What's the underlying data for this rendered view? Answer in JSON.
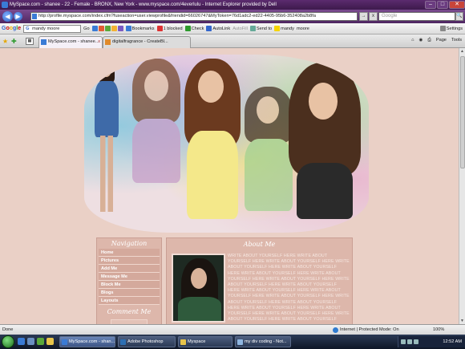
{
  "window": {
    "title": "MySpace.com - shanee - 22 - Female - BRONX, New York - www.myspace.com/4everlulu - Internet Explorer provided by Dell",
    "controls": {
      "minimize": "–",
      "maximize": "□",
      "close": "✕"
    }
  },
  "address_bar": {
    "url": "http://profile.myspace.com/index.cfm?fuseaction=user.viewprofile&friendid=66026747&MyToken=76d1adc2-ed22-4405-95b6-352408a2b8fa",
    "search_placeholder": "Google",
    "go_label": "→",
    "refresh_label": "x",
    "search_btn": "🔍"
  },
  "google_toolbar": {
    "logo_letters": [
      "G",
      "o",
      "o",
      "g",
      "l",
      "e"
    ],
    "search_value": "mandy moore",
    "go_label": "Go",
    "bookmarks_label": "Bookmarks",
    "blocked_label": "1 blocked",
    "check_label": "Check",
    "autolink_label": "AutoLink",
    "autofill_label": "AutoFill",
    "sendto_label": "Send to",
    "term1": "mandy",
    "term2": "moore",
    "settings_label": "Settings"
  },
  "tabs": {
    "active_label": "MySpace.com - shanee...",
    "inactive_label": "digitalfragrance - CreateBl...",
    "close_label": "x",
    "grid_label": "▦",
    "command_bar": [
      "Page",
      "Tools"
    ]
  },
  "profile": {
    "navigation_title": "Navigation",
    "nav_links": [
      "Home",
      "Pictures",
      "Add Me",
      "Message Me",
      "Block Me",
      "Blogs",
      "Layouts"
    ],
    "comment_title": "Comment Me",
    "about_title": "About Me",
    "about_text": "WRITE ABOUT YOURSELF HERE WRITE ABOUT YOURSELF HERE WRITE ABOUT YOURSELF HERE WRITE ABOUT YOURSELF HERE WRITE ABOUT YOURSELF HERE WRITE ABOUT YOURSELF HERE WRITE ABOUT YOURSELF HERE WRITE ABOUT YOURSELF HERE WRITE ABOUT YOURSELF HERE WRITE ABOUT YOURSELF HERE WRITE ABOUT YOURSELF HERE WRITE ABOUT YOURSELF HERE WRITE ABOUT YOURSELF HERE WRITE ABOUT YOURSELF HERE WRITE ABOUT YOURSELF HERE WRITE ABOUT YOURSELF HERE WRITE ABOUT YOURSELF HERE WRITE ABOUT YOURSELF HERE WRITE ABOUT YOURSELF HERE WRITE ABOUT YOURSELF HERE WRITE ABOUT YOURSELF HERE WRITE ABOUT YOURSELF HERE WRITE ABOUT YOURSELF"
  },
  "status_bar": {
    "status_text": "Done",
    "zone_text": "Internet | Protected Mode: On",
    "zoom_text": "100%"
  },
  "taskbar": {
    "items": [
      {
        "label": "MySpace.com - shan...",
        "icon_color": "#3a7bd5"
      },
      {
        "label": "Adobe Photoshop",
        "icon_color": "#2d6fb3"
      },
      {
        "label": "Myspace",
        "icon_color": "#e7c44a"
      },
      {
        "label": "my div coding - Not...",
        "icon_color": "#8fb6e0"
      }
    ],
    "clock": "12:52 AM"
  },
  "colors": {
    "page_background": "#ead0c6",
    "panel_background": "#ddb7ab",
    "titlebar": "#4e2661"
  }
}
